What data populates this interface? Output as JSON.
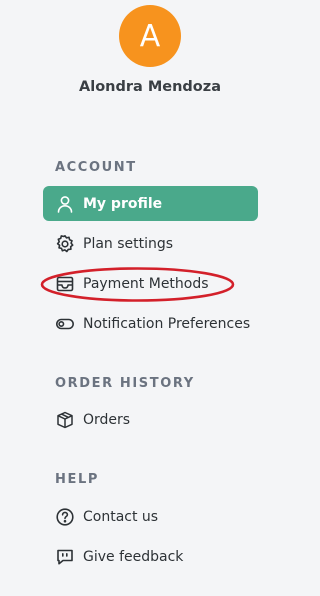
{
  "profile": {
    "avatar_initial": "A",
    "name": "Alondra Mendoza",
    "avatar_color": "#f7931e"
  },
  "sections": {
    "account": {
      "title": "ACCOUNT",
      "items": [
        {
          "label": "My profile",
          "icon": "person-icon",
          "active": true
        },
        {
          "label": "Plan settings",
          "icon": "gear-icon"
        },
        {
          "label": "Payment Methods",
          "icon": "wallet-icon"
        },
        {
          "label": "Notification Preferences",
          "icon": "toggle-icon"
        }
      ]
    },
    "order_history": {
      "title": "ORDER HISTORY",
      "items": [
        {
          "label": "Orders",
          "icon": "box-icon"
        }
      ]
    },
    "help": {
      "title": "HELP",
      "items": [
        {
          "label": "Contact us",
          "icon": "question-circle-icon"
        },
        {
          "label": "Give feedback",
          "icon": "feedback-bubble-icon"
        }
      ]
    }
  },
  "colors": {
    "active_item_bg": "#4aa98b",
    "highlight_ellipse": "#d3202a",
    "background": "#f4f5f7"
  }
}
